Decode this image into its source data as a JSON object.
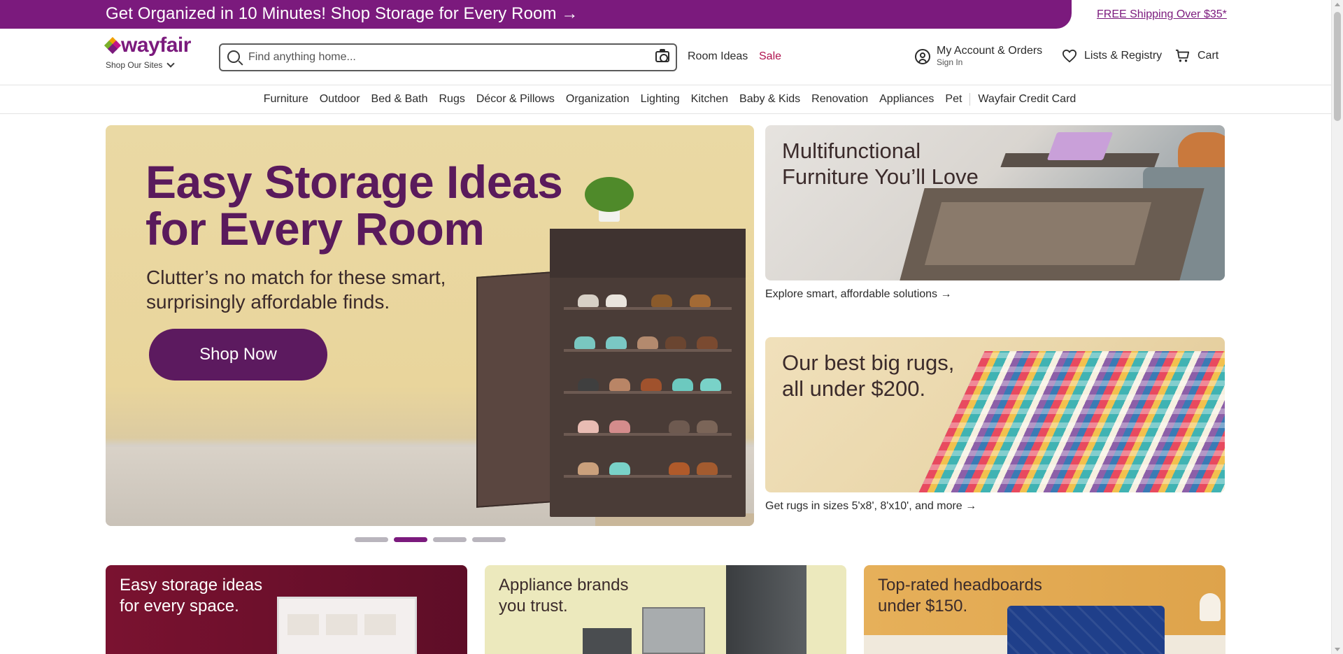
{
  "promo_bar": {
    "left_text": "Get Organized in 10 Minutes! Shop Storage for Every Room →",
    "right_link": "FREE Shipping Over $35*"
  },
  "header": {
    "logo_text": "wayfair",
    "shop_sites": "Shop Our Sites",
    "search": {
      "placeholder": "Find anything home..."
    },
    "room_ideas": "Room Ideas",
    "sale": "Sale",
    "account": {
      "title": "My Account & Orders",
      "subtitle": "Sign In"
    },
    "lists": "Lists & Registry",
    "cart": "Cart"
  },
  "nav": {
    "items": [
      "Furniture",
      "Outdoor",
      "Bed & Bath",
      "Rugs",
      "Décor & Pillows",
      "Organization",
      "Lighting",
      "Kitchen",
      "Baby & Kids",
      "Renovation",
      "Appliances",
      "Pet"
    ],
    "credit_card": "Wayfair Credit Card"
  },
  "hero": {
    "title_line1": "Easy Storage Ideas",
    "title_line2": "for Every Room",
    "subtitle_line1": "Clutter’s no match for these smart,",
    "subtitle_line2": "surprisingly affordable finds.",
    "button": "Shop Now",
    "carousel": {
      "slides": 4,
      "active_index": 1
    }
  },
  "side_promos": [
    {
      "title_line1": "Multifunctional",
      "title_line2": "Furniture You’ll Love",
      "caption": "Explore smart, affordable solutions →"
    },
    {
      "title_line1": "Our best big rugs,",
      "title_line2": "all under $200.",
      "caption": "Get rugs in sizes 5'x8', 8'x10', and more →"
    }
  ],
  "bottom_cards": [
    {
      "line1": "Easy storage ideas",
      "line2": "for every space."
    },
    {
      "line1": "Appliance brands",
      "line2": "you trust."
    },
    {
      "line1": "Top-rated headboards",
      "line2": "under $150."
    }
  ],
  "colors": {
    "brand_purple": "#7b1a7d",
    "hero_title": "#5a1a5c",
    "sale_red": "#b0134f"
  }
}
